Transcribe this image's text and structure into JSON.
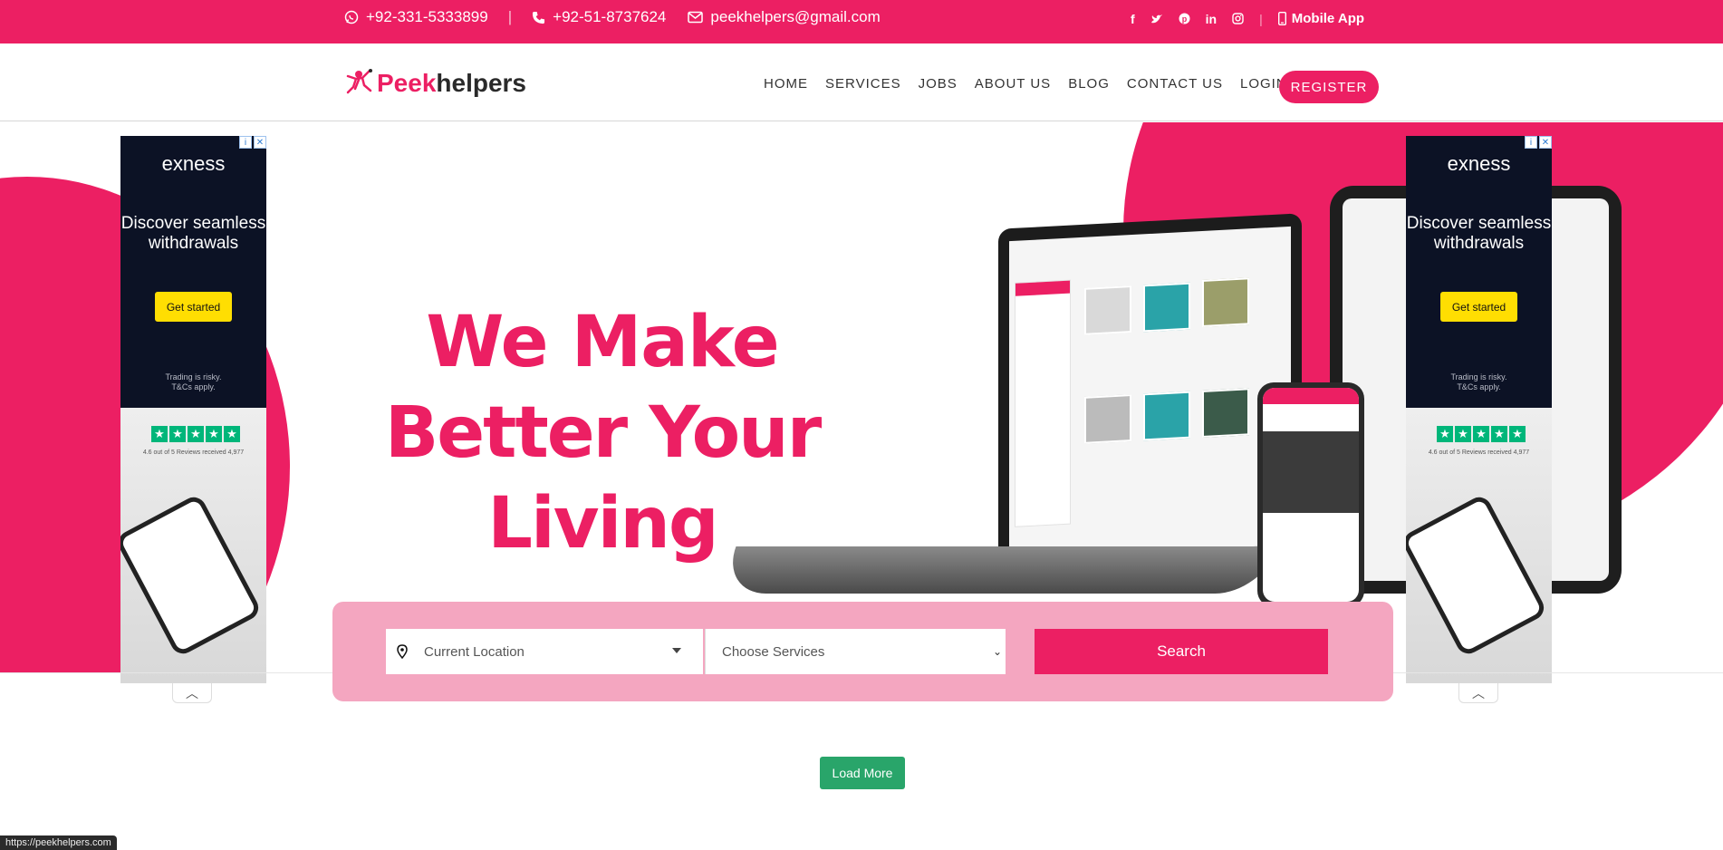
{
  "topbar": {
    "whatsapp": "+92-331-5333899",
    "phone": "+92-51-8737624",
    "email": "peekhelpers@gmail.com",
    "social_icons": [
      "facebook-icon",
      "twitter-icon",
      "pinterest-icon",
      "linkedin-icon",
      "instagram-icon"
    ],
    "mobile_app": "Mobile App"
  },
  "brand": {
    "peek": "Peek",
    "helpers": "helpers"
  },
  "nav": {
    "items": [
      "HOME",
      "SERVICES",
      "JOBS",
      "ABOUT US",
      "BLOG",
      "CONTACT US",
      "LOGIN"
    ],
    "register": "REGISTER"
  },
  "hero": {
    "line1": "We Make",
    "line2": "Better Your Living"
  },
  "ads": [
    {
      "brand": "exness",
      "message": "Discover seamless withdrawals",
      "cta": "Get started",
      "risk_line1": "Trading is risky.",
      "risk_line2": "T&Cs apply.",
      "rating": "4.6 out of 5 Reviews received 4,977"
    },
    {
      "brand": "exness",
      "message": "Discover seamless withdrawals",
      "cta": "Get started",
      "risk_line1": "Trading is risky.",
      "risk_line2": "T&Cs apply.",
      "rating": "4.6 out of 5 Reviews received 4,977"
    }
  ],
  "search": {
    "location_placeholder": "Current Location",
    "services_placeholder": "Choose Services",
    "button": "Search"
  },
  "load_more": "Load More",
  "status_url": "https://peekhelpers.com",
  "colors": {
    "accent": "#ec1f63",
    "search_bg": "#f4a6c0",
    "load_more": "#29a56a",
    "ad_bg": "#0c1225",
    "ad_cta": "#ffde02"
  }
}
